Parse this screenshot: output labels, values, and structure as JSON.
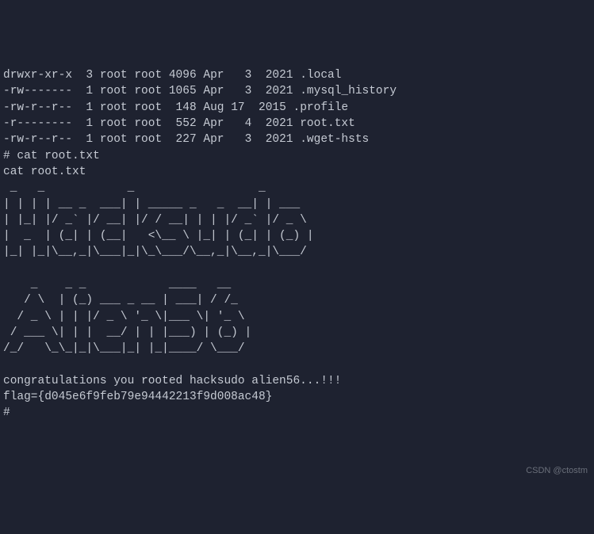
{
  "ls": {
    "rows": [
      {
        "perm": "drwxr-xr-x",
        "links": "3",
        "owner": "root",
        "group": "root",
        "size": "4096",
        "month": "Apr",
        "day": " 3",
        "year": "2021",
        "name": ".local"
      },
      {
        "perm": "-rw-------",
        "links": "1",
        "owner": "root",
        "group": "root",
        "size": "1065",
        "month": "Apr",
        "day": " 3",
        "year": "2021",
        "name": ".mysql_history"
      },
      {
        "perm": "-rw-r--r--",
        "links": "1",
        "owner": "root",
        "group": "root",
        "size": " 148",
        "month": "Aug",
        "day": "17",
        "year": "2015",
        "name": ".profile"
      },
      {
        "perm": "-r--------",
        "links": "1",
        "owner": "root",
        "group": "root",
        "size": " 552",
        "month": "Apr",
        "day": " 4",
        "year": "2021",
        "name": "root.txt"
      },
      {
        "perm": "-rw-r--r--",
        "links": "1",
        "owner": "root",
        "group": "root",
        "size": " 227",
        "month": "Apr",
        "day": " 3",
        "year": "2021",
        "name": ".wget-hsts"
      }
    ]
  },
  "commands": {
    "prompt1": "# cat root.txt",
    "echo1": "cat root.txt",
    "prompt2": "# "
  },
  "ascii_art": {
    "l01": " _   _            _                  _               ",
    "l02": "| | | | __ _  ___| | _____ _   _  __| | ___          ",
    "l03": "| |_| |/ _` |/ __| |/ / __| | | |/ _` |/ _ \\         ",
    "l04": "|  _  | (_| | (__|   <\\__ \\ |_| | (_| | (_) |        ",
    "l05": "|_| |_|\\__,_|\\___|_|\\_\\___/\\__,_|\\__,_|\\___/         ",
    "l06": "                                                   ",
    "l07": "    _    _ _            ____   __           ",
    "l08": "   / \\  | (_) ___ _ __ | ___| / /_          ",
    "l09": "  / _ \\ | | |/ _ \\ '_ \\|___ \\| '_ \\         ",
    "l10": " / ___ \\| | |  __/ | | |___) | (_) |        ",
    "l11": "/_/   \\_\\_|_|\\___|_| |_|____/ \\___/          "
  },
  "messages": {
    "congrats": "congratulations you rooted hacksudo alien56...!!!",
    "flag": "flag={d045e6f9feb79e94442213f9d008ac48}"
  },
  "watermark": "CSDN @ctostm"
}
